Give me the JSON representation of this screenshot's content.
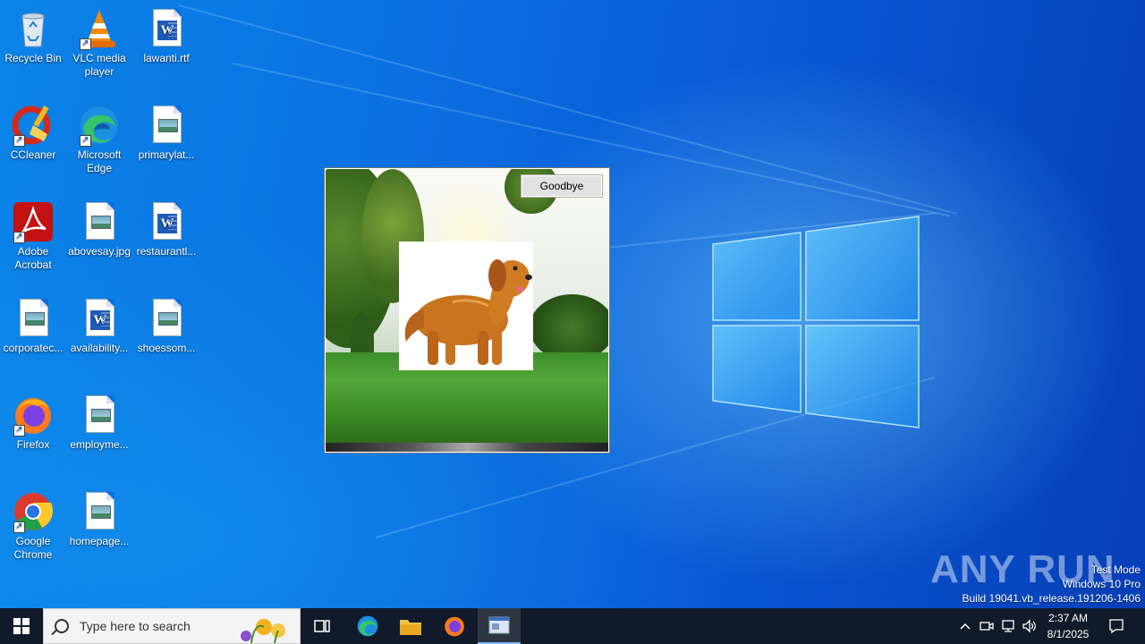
{
  "desktop": {
    "icons": [
      {
        "label": "Recycle Bin"
      },
      {
        "label": "VLC media player"
      },
      {
        "label": "lawanti.rtf"
      },
      {
        "label": "CCleaner"
      },
      {
        "label": "Microsoft Edge"
      },
      {
        "label": "primarylat..."
      },
      {
        "label": "Adobe Acrobat"
      },
      {
        "label": "abovesay.jpg"
      },
      {
        "label": "restaurantl..."
      },
      {
        "label": "corporatec..."
      },
      {
        "label": "availability..."
      },
      {
        "label": "shoessom..."
      },
      {
        "label": "Firefox"
      },
      {
        "label": "employme..."
      },
      {
        "label": "Google Chrome"
      },
      {
        "label": "homepage..."
      }
    ]
  },
  "popup": {
    "button_label": "Goodbye"
  },
  "watermark": {
    "brand": "ANY RUN",
    "line1": "Test Mode",
    "line2": "Windows 10 Pro",
    "line3": "Build 19041.vb_release.191206-1406"
  },
  "taskbar": {
    "search_placeholder": "Type here to search",
    "time": "2:37 AM",
    "date": "8/1/2025"
  },
  "colors": {
    "taskbar_bg": "#101a2a",
    "accent": "#0a6fe0"
  }
}
